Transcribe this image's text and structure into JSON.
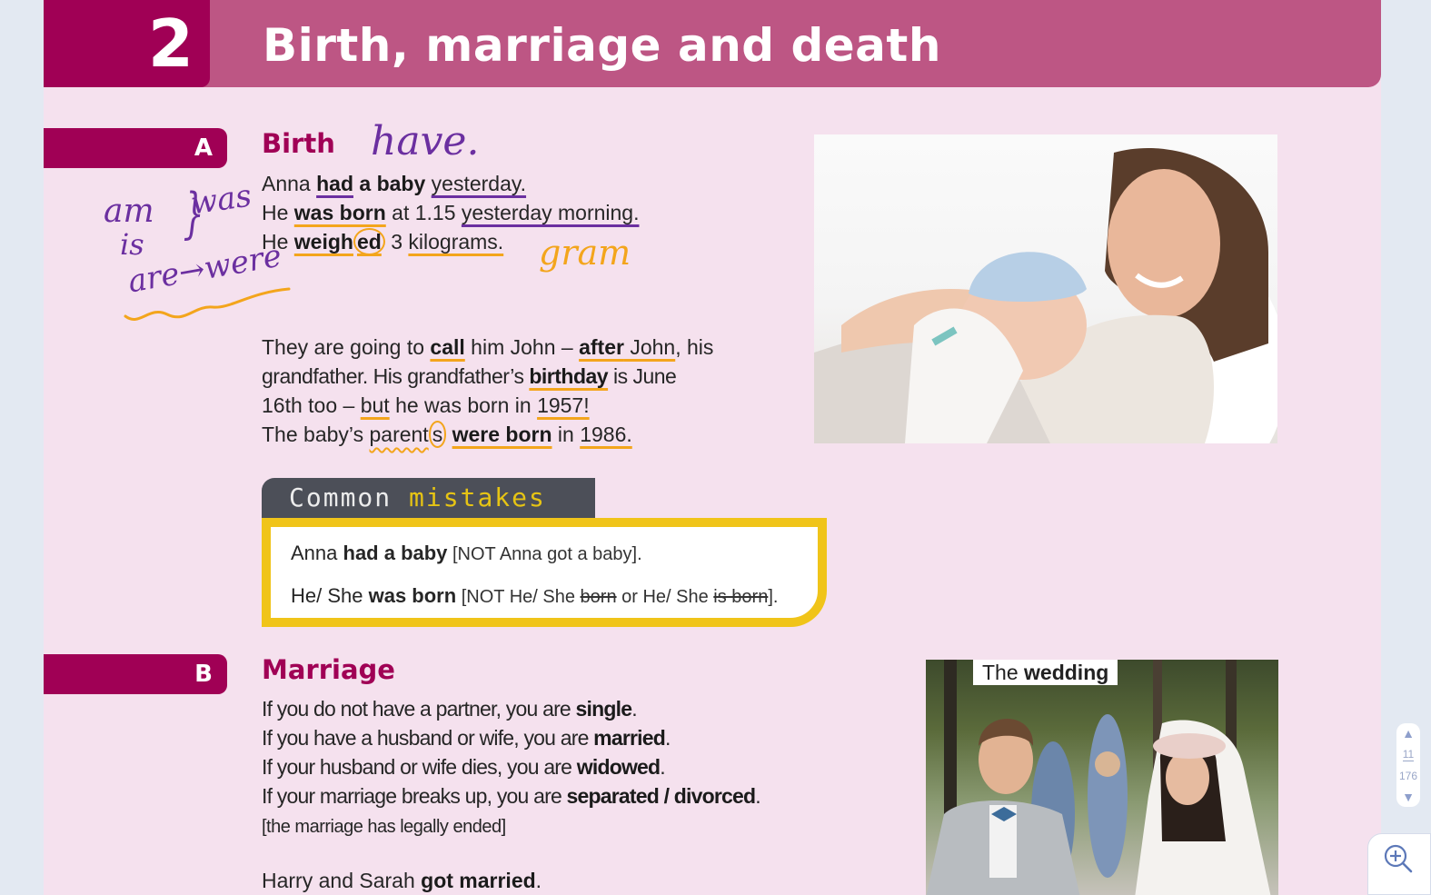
{
  "header": {
    "unit_number": "2",
    "title": "Birth, marriage and death"
  },
  "section_a": {
    "letter": "A",
    "title": "Birth",
    "lines": {
      "l1": {
        "p1": "Anna ",
        "b1": "had",
        "b2": " a baby",
        "p2": " ",
        "u": "yesterday."
      },
      "l2": {
        "p1": "He ",
        "b1": "was born",
        "p2": " at 1.15 ",
        "u": "yesterday morning."
      },
      "l3": {
        "p1": "He ",
        "b1": "weigh",
        "b2": "ed",
        "p2": " 3 ",
        "u": "kilograms."
      }
    },
    "para": {
      "l1": {
        "p1": "They are going to ",
        "b1": "call",
        "p2": " him John – ",
        "b2": "after",
        "p3": " John",
        "p4": ", his"
      },
      "l2": {
        "p1": "grandfather. His grandfather’s ",
        "b1": "birthday",
        "p2": " is June"
      },
      "l3": {
        "p1": "16th too – ",
        "u1": "but",
        "p2": " he was born in ",
        "u2": "1957!"
      },
      "l4": {
        "p1": "The baby’s ",
        "w1": "parent",
        "w2": "s",
        "p2": " ",
        "b1": "were born",
        "p3": " in ",
        "u1": "1986."
      }
    },
    "image_alt": "Mother holding a sleeping newborn baby in a blue hat"
  },
  "annotations": {
    "have": "have.",
    "am": "am",
    "is": "is",
    "brace": "}",
    "was": "was",
    "are_were": "are→were",
    "gram": "gram"
  },
  "common_mistakes": {
    "title_word1": "Common",
    "title_word2": "mistakes",
    "line1": {
      "p1": "Anna ",
      "b1": "had a baby",
      "not": " [NOT Anna got a baby]."
    },
    "line2": {
      "p1": "He/ She ",
      "b1": "was born",
      "not1": " [NOT He/ She ",
      "s1": "born",
      "not2": " or He/ She ",
      "s2": "is born",
      "not3": "]."
    }
  },
  "section_b": {
    "letter": "B",
    "title": "Marriage",
    "lines": [
      {
        "p": "If you do not have a partner, you are ",
        "b": "single",
        "e": "."
      },
      {
        "p": "If you have a husband or wife, you are ",
        "b": "married",
        "e": "."
      },
      {
        "p": "If your husband or wife dies, you are ",
        "b": "widowed",
        "e": "."
      },
      {
        "p": "If your marriage breaks up, you are ",
        "b": "separated / divorced",
        "e": "."
      }
    ],
    "note": "[the marriage has legally ended]",
    "last": {
      "p": "Harry and Sarah ",
      "b": "got married",
      "e": "."
    },
    "image_caption_plain": "The ",
    "image_caption_bold": "wedding"
  },
  "viewer": {
    "current_page": "11",
    "total_pages": "176",
    "up_arrow": "▲",
    "down_arrow": "▼"
  },
  "colors": {
    "brand_dark": "#a00055",
    "brand_light": "#bd5684",
    "page_bg": "#f5e1ee",
    "annotation_purple": "#6b2fa0",
    "annotation_orange": "#f3a51c",
    "mistakes_border": "#f0c419"
  }
}
